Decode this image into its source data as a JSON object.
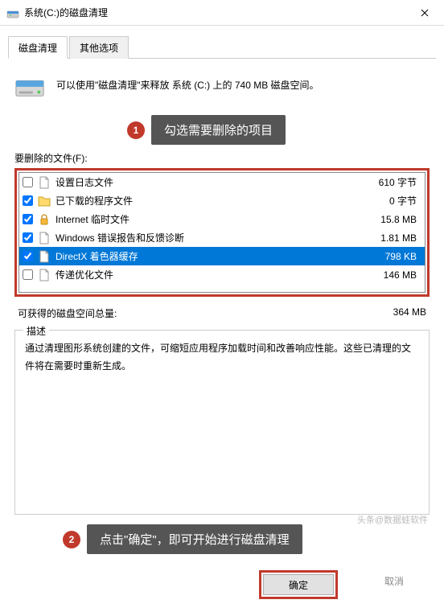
{
  "window": {
    "title": "系统(C:)的磁盘清理"
  },
  "tabs": {
    "t0": "磁盘清理",
    "t1": "其他选项"
  },
  "intro": "可以使用\"磁盘清理\"来释放 系统 (C:) 上的 740 MB 磁盘空间。",
  "annotations": {
    "a1_num": "1",
    "a1_text": "勾选需要删除的项目",
    "a2_num": "2",
    "a2_text": "点击\"确定\"，即可开始进行磁盘清理"
  },
  "section": {
    "files_label": "要删除的文件(F):",
    "total_label": "可获得的磁盘空间总量:",
    "total_value": "364 MB",
    "desc_legend": "描述",
    "desc_text": "通过清理图形系统创建的文件，可缩短应用程序加载时间和改善响应性能。这些已清理的文件将在需要时重新生成。"
  },
  "files": [
    {
      "checked": false,
      "icon": "page",
      "name": "设置日志文件",
      "size": "610 字节"
    },
    {
      "checked": true,
      "icon": "folder",
      "name": "已下载的程序文件",
      "size": "0 字节"
    },
    {
      "checked": true,
      "icon": "lock",
      "name": "Internet 临时文件",
      "size": "15.8 MB"
    },
    {
      "checked": true,
      "icon": "page",
      "name": "Windows 错误报告和反馈诊断",
      "size": "1.81 MB"
    },
    {
      "checked": true,
      "icon": "page",
      "name": "DirectX 着色器缓存",
      "size": "798 KB",
      "selected": true
    },
    {
      "checked": false,
      "icon": "page",
      "name": "传递优化文件",
      "size": "146 MB"
    }
  ],
  "buttons": {
    "ok": "确定",
    "cancel": "取消"
  },
  "watermark": "头条@数据蛙软件"
}
